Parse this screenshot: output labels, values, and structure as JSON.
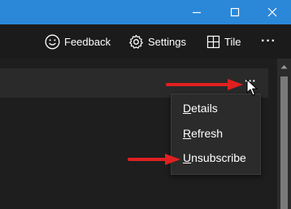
{
  "window": {
    "minimize_icon": "minimize-icon",
    "maximize_icon": "maximize-icon",
    "close_icon": "close-icon",
    "titlebar_color": "#2b87d8"
  },
  "toolbar": {
    "feedback_label": "Feedback",
    "settings_label": "Settings",
    "tile_label": "Tile",
    "more_label": "···"
  },
  "row": {
    "more_label": "···"
  },
  "context_menu": {
    "items": [
      {
        "mnemonic": "D",
        "rest": "etails"
      },
      {
        "mnemonic": "R",
        "rest": "efresh"
      },
      {
        "mnemonic": "U",
        "rest": "nsubscribe"
      }
    ]
  },
  "annotation": {
    "arrow_color": "#e02020"
  }
}
